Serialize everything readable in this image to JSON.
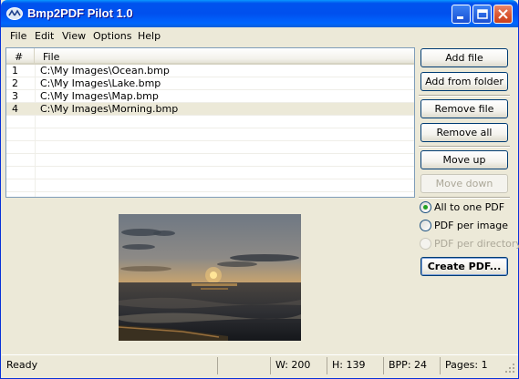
{
  "window": {
    "title": "Bmp2PDF Pilot 1.0",
    "colors": {
      "titlebar": "#0055ea",
      "selection": "#ece9d8",
      "radio_check": "#21a121"
    }
  },
  "menu": [
    "File",
    "Edit",
    "View",
    "Options",
    "Help"
  ],
  "file_list": {
    "headers": {
      "num": "#",
      "file": "File"
    },
    "rows": [
      {
        "num": "1",
        "file": "C:\\My Images\\Ocean.bmp",
        "selected": false
      },
      {
        "num": "2",
        "file": "C:\\My Images\\Lake.bmp",
        "selected": false
      },
      {
        "num": "3",
        "file": "C:\\My Images\\Map.bmp",
        "selected": false
      },
      {
        "num": "4",
        "file": "C:\\My Images\\Morning.bmp",
        "selected": true
      }
    ]
  },
  "buttons": {
    "add_file": "Add file",
    "add_folder": "Add from folder",
    "remove_file": "Remove file",
    "remove_all": "Remove all",
    "move_up": "Move up",
    "move_down": "Move down",
    "create_pdf": "Create PDF..."
  },
  "options": {
    "all_to_one": "All to one PDF",
    "per_image": "PDF per image",
    "per_directory": "PDF per directory",
    "selected": "all_to_one"
  },
  "preview": {
    "image": "sunset-over-sea-photo"
  },
  "status": {
    "text": "Ready",
    "width": "W: 200",
    "height": "H: 139",
    "bpp": "BPP: 24",
    "pages": "Pages: 1"
  }
}
